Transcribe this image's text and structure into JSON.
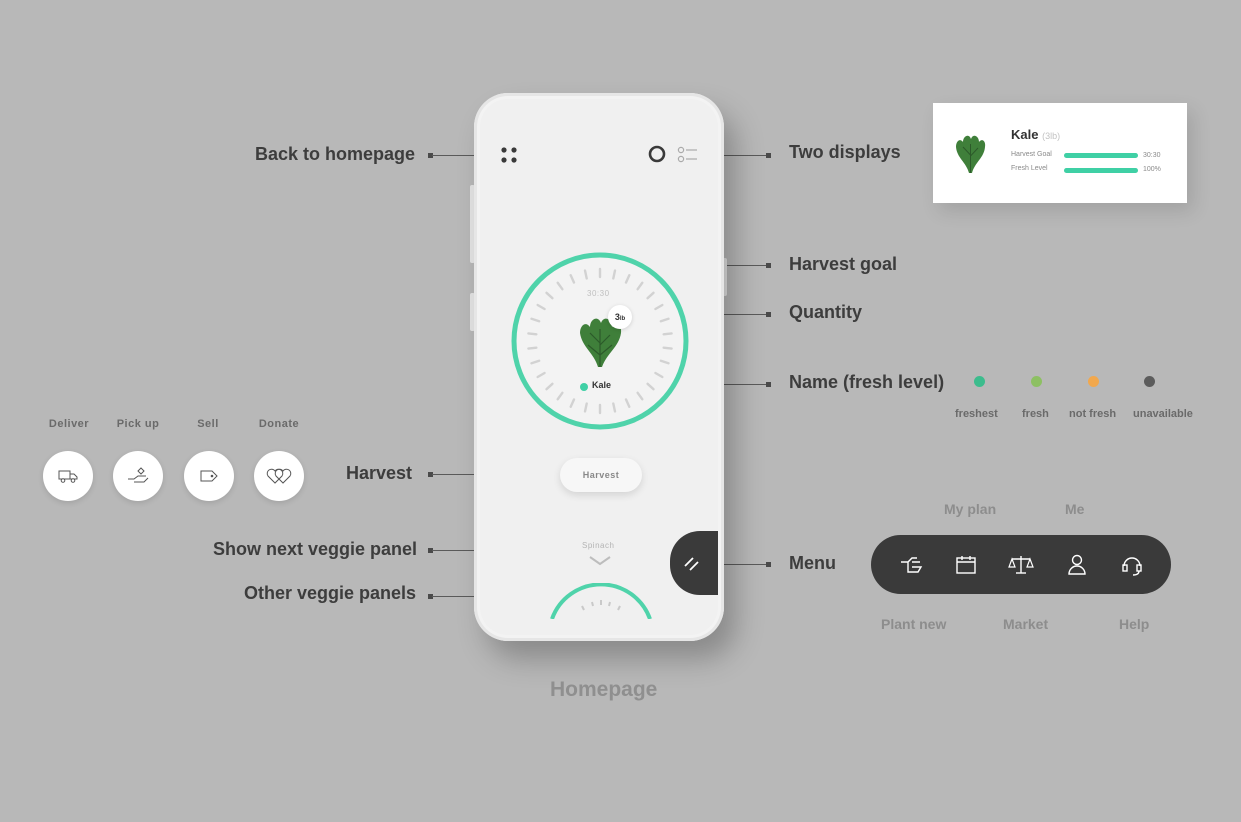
{
  "caption": "Homepage",
  "annotations": {
    "back_to_homepage": "Back to homepage",
    "two_displays": "Two displays",
    "harvest_goal": "Harvest goal",
    "quantity": "Quantity",
    "name_fresh_level": "Name (fresh level)",
    "harvest": "Harvest",
    "show_next_veggie_panel": "Show next veggie panel",
    "other_veggie_panels": "Other veggie panels",
    "menu": "Menu"
  },
  "phone": {
    "dial_goal": "30:30",
    "quantity_number": "3",
    "quantity_unit": "lb",
    "veggie_name": "Kale",
    "harvest_button": "Harvest",
    "next_veggie": "Spinach",
    "menu_button_icon": "menu-slash-icon"
  },
  "goal_card": {
    "name": "Kale",
    "qty": "(3lb)",
    "harvest_goal_label": "Harvest Goal",
    "harvest_goal_value": "30:30",
    "harvest_goal_fill": 1.0,
    "fresh_level_label": "Fresh Level",
    "fresh_level_value": "100%",
    "fresh_level_fill": 1.0
  },
  "fresh_levels": [
    {
      "label": "freshest",
      "color": "#3cbc8d"
    },
    {
      "label": "fresh",
      "color": "#8dc063"
    },
    {
      "label": "not fresh",
      "color": "#f2a84d"
    },
    {
      "label": "unavailable",
      "color": "#5c5c5c"
    }
  ],
  "actions": [
    {
      "label": "Deliver",
      "icon": "truck-icon"
    },
    {
      "label": "Pick up",
      "icon": "hand-pickup-icon"
    },
    {
      "label": "Sell",
      "icon": "price-tag-icon"
    },
    {
      "label": "Donate",
      "icon": "hearts-icon"
    }
  ],
  "menu": {
    "top_labels": [
      "My plan",
      "Me"
    ],
    "bottom_labels": [
      "Plant new",
      "Market",
      "Help"
    ],
    "icons": [
      "plant-hand-icon",
      "calendar-icon",
      "scale-icon",
      "person-icon",
      "headset-icon"
    ]
  },
  "colors": {
    "accent": "#3fd0a5",
    "background": "#b8b8b8",
    "menu_bg": "#3a3a3a"
  }
}
